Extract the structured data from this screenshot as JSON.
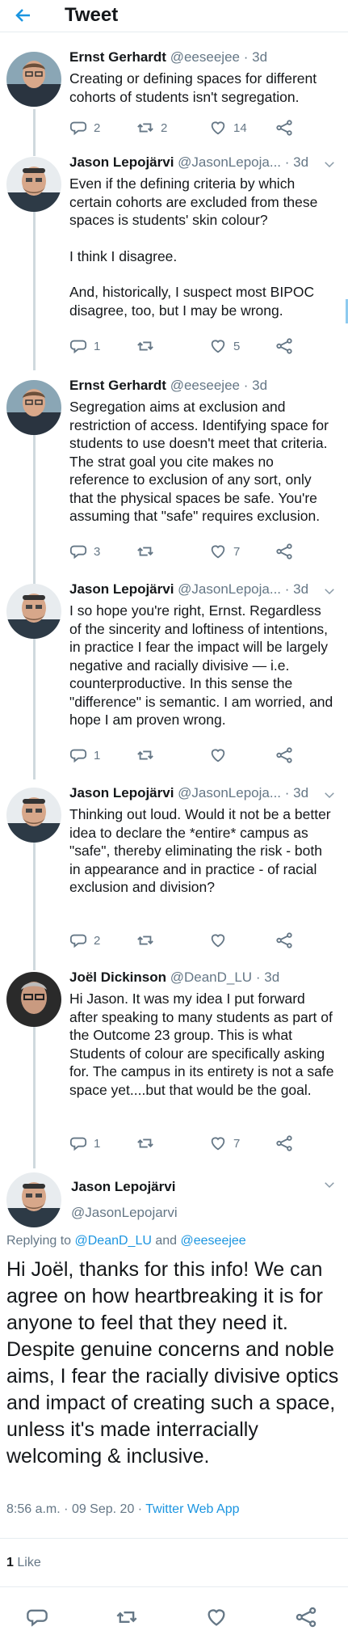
{
  "header": {
    "title": "Tweet"
  },
  "tweets": [
    {
      "name": "Ernst Gerhardt",
      "handle": "@eeseejee",
      "time": "3d",
      "body": [
        "Creating or defining  spaces for different cohorts of students isn't segregation."
      ],
      "replies": "2",
      "retweets": "2",
      "likes": "14"
    },
    {
      "name": "Jason Lepojärvi",
      "handle": "@JasonLepoja...",
      "time": "3d",
      "body": [
        "Even if the defining criteria by which certain cohorts are excluded from these spaces is students' skin colour?",
        "I think I disagree.",
        "And, historically, I suspect most BIPOC disagree, too, but I may be wrong."
      ],
      "replies": "1",
      "retweets": "",
      "likes": "5"
    },
    {
      "name": "Ernst Gerhardt",
      "handle": "@eeseejee",
      "time": "3d",
      "body": [
        "Segregation aims at exclusion and restriction of access. Identifying space for students to use doesn't meet that criteria. The strat goal you cite makes no reference to exclusion of any sort, only that the physical spaces be safe. You're assuming that \"safe\" requires exclusion."
      ],
      "replies": "3",
      "retweets": "",
      "likes": "7"
    },
    {
      "name": "Jason Lepojärvi",
      "handle": "@JasonLepoja...",
      "time": "3d",
      "body": [
        "I so hope you're right, Ernst. Regardless of the sincerity and loftiness of intentions, in practice I fear the impact will be largely negative and racially divisive — i.e. counterproductive. In this sense the \"difference\" is semantic. I am worried, and hope I am proven wrong."
      ],
      "replies": "1",
      "retweets": "",
      "likes": ""
    },
    {
      "name": "Jason Lepojärvi",
      "handle": "@JasonLepoja...",
      "time": "3d",
      "body": [
        "Thinking out loud. Would it not be a better idea to declare the *entire* campus as \"safe\", thereby eliminating the risk - both in appearance and in practice - of racial exclusion and division?"
      ],
      "replies": "2",
      "retweets": "",
      "likes": ""
    },
    {
      "name": "Joël Dickinson",
      "handle": "@DeanD_LU",
      "time": "3d",
      "body": [
        "Hi Jason. It was my idea I put forward after speaking to many students as part of the Outcome 23 group. This is what Students of colour are specifically asking for. The campus in its entirety is not a safe space yet....but that would be the goal."
      ],
      "replies": "1",
      "retweets": "",
      "likes": "7"
    }
  ],
  "main_tweet": {
    "name": "Jason Lepojärvi",
    "handle": "@JasonLepojarvi",
    "replying_prefix": "Replying to",
    "replying_user1": "@DeanD_LU",
    "replying_and": "and",
    "replying_user2": "@eeseejee",
    "body": "Hi Joël, thanks for this info! We can agree on how heartbreaking it is for anyone to feel that they need it. Despite genuine concerns and noble aims, I fear the racially divisive optics and impact of creating such a space, unless it's made interracially welcoming & inclusive.",
    "time": "8:56 a.m.",
    "date": "09 Sep. 20",
    "source": "Twitter Web App",
    "separator": "·",
    "likes_count": "1",
    "likes_label": "Like"
  },
  "icons": {
    "back": "arrow-left-icon",
    "reply": "comment-icon",
    "retweet": "retweet-icon",
    "like": "heart-icon",
    "share": "share-icon",
    "menu": "chevron-down-icon"
  },
  "colors": {
    "accent": "#1b95e0",
    "secondary": "#657786",
    "text": "#14171a",
    "line": "#cfd9de"
  }
}
